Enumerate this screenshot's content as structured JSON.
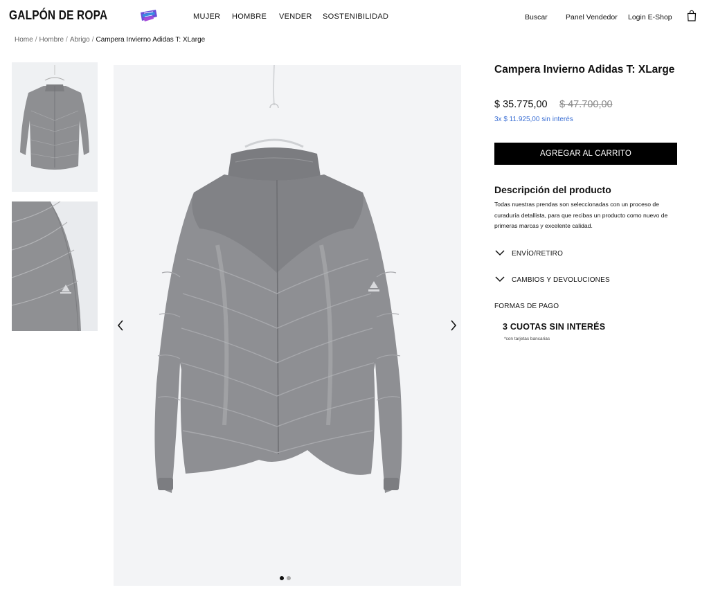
{
  "header": {
    "brand": "GALPÓN DE ROPA",
    "nav": [
      {
        "label": "MUJER"
      },
      {
        "label": "HOMBRE"
      },
      {
        "label": "VENDER"
      },
      {
        "label": "SOSTENIBILIDAD"
      }
    ],
    "links": [
      {
        "label": "Buscar"
      },
      {
        "label": "Panel Vendedor"
      },
      {
        "label": "Login E-Shop"
      }
    ],
    "cart_icon": "shopping-bag-icon"
  },
  "breadcrumb": {
    "items": [
      "Home",
      "Hombre",
      "Abrigo"
    ],
    "separator": "/",
    "current": "Campera Invierno Adidas T: XLarge"
  },
  "gallery": {
    "thumbnails": [
      {
        "alt": "Campera gris vista frontal"
      },
      {
        "alt": "Detalle manga con logo adidas"
      }
    ],
    "active_slide": 1,
    "total_slides": 2,
    "prev_icon": "chevron-left-icon",
    "next_icon": "chevron-right-icon"
  },
  "product": {
    "title": "Campera Invierno Adidas T: XLarge",
    "price": "$ 35.775,00",
    "price_old": "$ 47.700,00",
    "installments": "3x $ 11.925,00 sin interés",
    "add_to_cart": "AGREGAR AL CARRITO",
    "description_title": "Descripción del producto",
    "description": "Todas nuestras prendas son seleccionadas con un proceso de curaduría detallista, para que recibas un producto como nuevo de primeras marcas y excelente calidad.",
    "accordions": [
      {
        "label": "ENVÍO/RETIRO"
      },
      {
        "label": "CAMBIOS Y DEVOLUCIONES"
      }
    ],
    "payment_title": "FORMAS DE PAGO",
    "payment_highlight": "3 CUOTAS SIN INTERÉS",
    "payment_note": "*con tarjetas bancarias"
  },
  "colors": {
    "accent_link": "#3b6fd4",
    "button_bg": "#000000",
    "jacket_gray": "#8e8f92"
  }
}
